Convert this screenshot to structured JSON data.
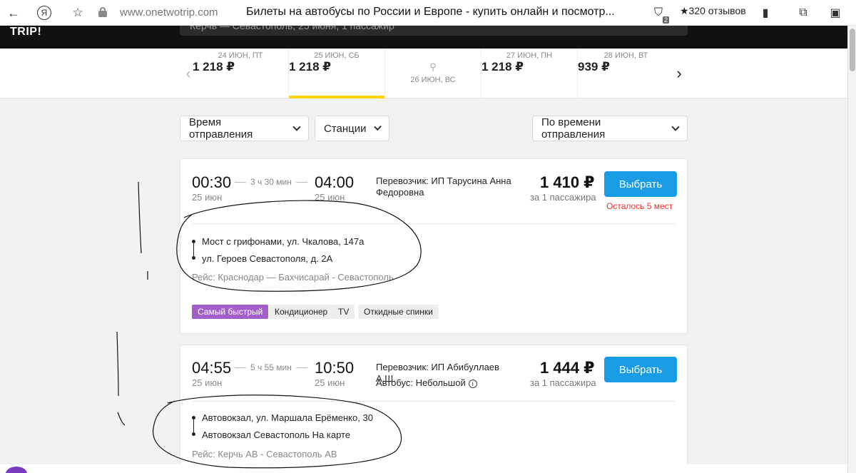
{
  "browser": {
    "url": "www.onetwotrip.com",
    "title": "Билеты на автобусы по России и Европе - купить онлайн и посмотр...",
    "reviews": "★320 отзывов",
    "shield_badge": "2"
  },
  "site": {
    "logo": "TRIP!",
    "search_partial": "Керчь — Севастополь, 25 июня, 1 пассажир"
  },
  "dates": [
    {
      "price": "1 218 ₽",
      "date": "24 июн, пт"
    },
    {
      "price": "1 218 ₽",
      "date": "25 июн, сб",
      "active": true
    },
    {
      "price": "",
      "date": "26 июн, вс",
      "icon": "search-icon"
    },
    {
      "price": "1 218 ₽",
      "date": "27 июн, пн"
    },
    {
      "price": "939 ₽",
      "date": "28 июн, вт"
    }
  ],
  "filters": {
    "time": "Время отправления",
    "stations": "Станции",
    "sort": "По времени отправления"
  },
  "trips": [
    {
      "dep_time": "00:30",
      "dep_date": "25 июн",
      "duration": "3 ч 30 мин",
      "arr_time": "04:00",
      "arr_date": "25 июн",
      "carrier": "Перевозчик: ИП Тарусина Анна Федоровна",
      "price": "1 410 ₽",
      "per_pax": "за 1 пассажира",
      "button": "Выбрать",
      "seats_left": "Осталось 5 мест",
      "from_stop": "Мост с грифонами, ул. Чкалова, 147а",
      "to_stop": "ул. Героев Севастополя, д. 2А",
      "route": "Рейс:  Краснодар — Бахчисарай - Севастополь",
      "tags": [
        "Самый быстрый",
        "Кондиционер",
        "TV",
        "Откидные спинки"
      ]
    },
    {
      "dep_time": "04:55",
      "dep_date": "25 июн",
      "duration": "5 ч 55 мин",
      "arr_time": "10:50",
      "arr_date": "25 июн",
      "carrier": "Перевозчик: ИП Абибуллаев А.Ш.",
      "bus": "Автобус: Небольшой",
      "price": "1 444 ₽",
      "per_pax": "за 1 пассажира",
      "button": "Выбрать",
      "from_stop": "Автовокзал, ул. Маршала Ерёменко, 30",
      "to_stop": "Автовокзал Севастополь",
      "map_link": "На карте",
      "route": "Рейс:  Керчь АВ - Севастополь АВ"
    }
  ]
}
